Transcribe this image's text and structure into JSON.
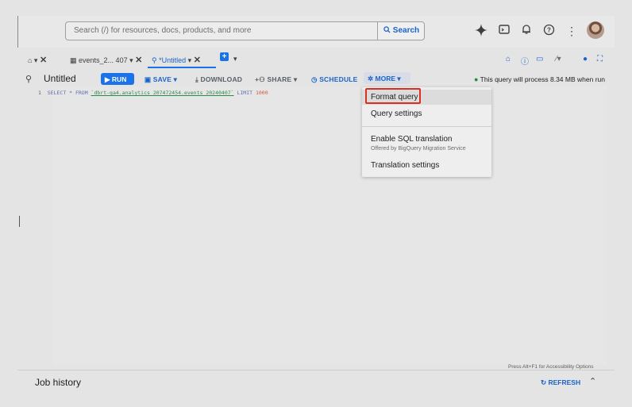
{
  "search": {
    "placeholder": "Search (/) for resources, docs, products, and more",
    "button": "Search"
  },
  "tabs": [
    {
      "label": "events_2... 407"
    },
    {
      "label": "*Untitled"
    }
  ],
  "toolbar": {
    "title": "Untitled",
    "run": "RUN",
    "save": "SAVE",
    "download": "DOWNLOAD",
    "share": "SHARE",
    "schedule": "SCHEDULE",
    "more": "MORE",
    "process_text": "This query will process 8.34 MB when run"
  },
  "editor": {
    "line_number": "1",
    "kw1": "SELECT * FROM ",
    "table": "`dbrt-ga4.analytics_207472454.events_20240407`",
    "kw2": " LIMIT ",
    "limit": "1000",
    "accessibility_hint": "Press Alt+F1 for Accessibility Options"
  },
  "menu": {
    "items": [
      {
        "label": "Format query"
      },
      {
        "label": "Query settings"
      },
      {
        "label": "Enable SQL translation",
        "sub": "Offered by BigQuery Migration Service"
      },
      {
        "label": "Translation settings"
      }
    ]
  },
  "job_history": {
    "title": "Job history",
    "refresh": "REFRESH"
  },
  "colors": {
    "accent": "#1a73e8",
    "highlight_border": "#d93025",
    "success": "#1e8e3e"
  },
  "icons": [
    "gemini-sparkle-icon",
    "cloud-shell-icon",
    "notifications-icon",
    "help-icon",
    "more-vert-icon",
    "account-avatar"
  ]
}
